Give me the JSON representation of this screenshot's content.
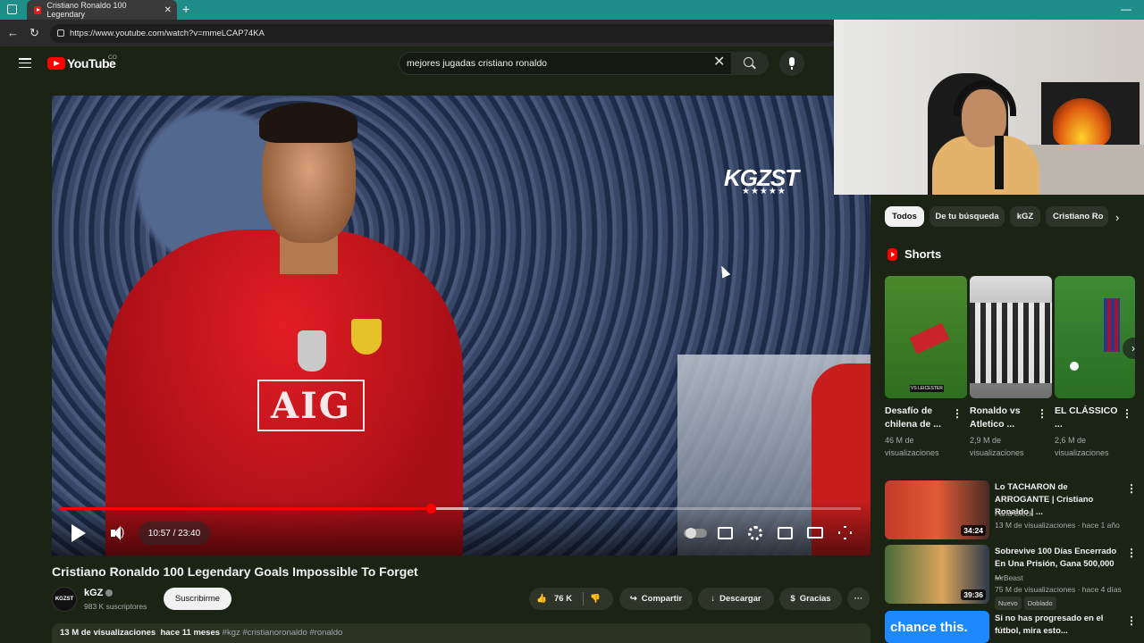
{
  "browser": {
    "tab_title": "Cristiano Ronaldo 100 Legendary",
    "tab_close": "✕",
    "new_tab": "+",
    "url": "https://www.youtube.com/watch?v=mmeLCAP74KA",
    "minimize": "—"
  },
  "youtube": {
    "logo_text": "YouTube",
    "country_code": "CO",
    "search_value": "mejores jugadas cristiano ronaldo",
    "search_clear": "✕"
  },
  "video": {
    "watermark": "KGZST",
    "watermark_stars": "★★★★★",
    "jersey_sponsor": "AIG",
    "time_display": "10:57 / 23:40",
    "progress_fraction": 0.463,
    "buffer_fraction": 0.51
  },
  "below": {
    "title": "Cristiano Ronaldo 100 Legendary Goals Impossible To Forget",
    "channel_name": "kGZ",
    "channel_avatar_text": "KGZST",
    "subscribers": "983 K suscriptores",
    "subscribe_label": "Suscribirme",
    "likes": "76 K",
    "share_label": "Compartir",
    "download_label": "Descargar",
    "thanks_label": "Gracias",
    "more": "···",
    "views": "13 M de visualizaciones",
    "age": "hace 11 meses",
    "hashtags": "#kgz #cristianoronaldo #ronaldo"
  },
  "sidebar": {
    "chips": [
      "Todos",
      "De tu búsqueda",
      "kGZ",
      "Cristiano Ro"
    ],
    "chip_next": "›",
    "shorts_label": "Shorts",
    "shorts_next": "›",
    "shorts": [
      {
        "title": "Desafío de chilena de ...",
        "views": "46 M de visualizaciones",
        "thumb_label": "VS LEICESTER"
      },
      {
        "title": "Ronaldo vs Atletico ...",
        "views": "2,9 M de visualizaciones"
      },
      {
        "title": "EL CLÁSSICO ...",
        "views": "2,6 M de visualizaciones"
      }
    ],
    "videos": [
      {
        "title": "Lo TACHARON de ARROGANTE | Cristiano Ronaldo | ...",
        "channel": "Farid Dieck",
        "meta": "13 M de visualizaciones · hace 1 año",
        "duration": "34:24"
      },
      {
        "title": "Sobrevive 100 Días Encerrado En Una Prisión, Gana 500,000 ...",
        "channel": "MrBeast",
        "meta": "75 M de visualizaciones · hace 4 días",
        "duration": "39:36",
        "tags": [
          "Nuevo",
          "Doblado"
        ]
      },
      {
        "title": "Si no has progresado en el fútbol, mira esto...",
        "thumb_text": "chance this."
      }
    ],
    "menu_dots": "⋮"
  },
  "colors": {
    "accent_red": "#ff0000",
    "page_bg": "#1b2314",
    "tab_strip": "#1f8e88"
  }
}
